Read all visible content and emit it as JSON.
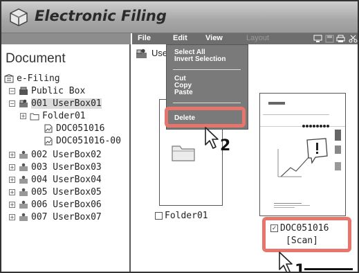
{
  "app": {
    "title": "Electronic Filing"
  },
  "left_pane": {
    "title": "Document",
    "tree": [
      {
        "label": "e-Filing"
      },
      {
        "label": "Public Box",
        "expander": "−"
      },
      {
        "label": "001 UserBox01",
        "expander": "−"
      },
      {
        "label": "Folder01",
        "expander": "+"
      },
      {
        "label": "DOC051016"
      },
      {
        "label": "DOC051016-00"
      },
      {
        "label": "002 UserBox02",
        "expander": "+"
      },
      {
        "label": "003 UserBox03",
        "expander": "+"
      },
      {
        "label": "004 UserBox04",
        "expander": "+"
      },
      {
        "label": "005 UserBox05",
        "expander": "+"
      },
      {
        "label": "006 UserBox06",
        "expander": "+"
      },
      {
        "label": "007 UserBox07",
        "expander": "+"
      }
    ]
  },
  "menubar": {
    "file": "File",
    "edit": "Edit",
    "view": "View",
    "layout": "Layout"
  },
  "location_label": "User",
  "edit_menu": {
    "select_all": "Select All",
    "invert_selection": "Invert Selection",
    "cut": "Cut",
    "copy": "Copy",
    "paste": "Paste",
    "delete": "Delete"
  },
  "items": {
    "folder": {
      "name": "Folder01",
      "checked": false
    },
    "document": {
      "name": "DOC051016",
      "type": "[Scan]",
      "checked": true
    }
  },
  "callouts": {
    "step1": "1",
    "step2": "2"
  },
  "colors": {
    "highlight": "#e8756c",
    "menubar": "#6e6e6e",
    "dropdown": "#7a7a7a",
    "titlebar": "#a7a7a7"
  }
}
